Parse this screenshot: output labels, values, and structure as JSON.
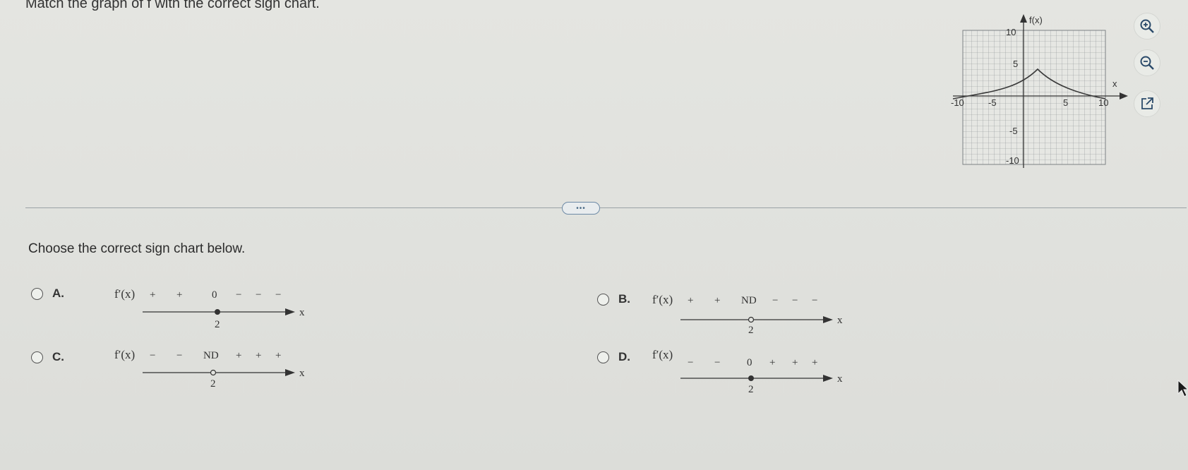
{
  "question": "Match the graph of f with the correct sign chart.",
  "graph": {
    "y_label": "f(x)",
    "x_label": "x",
    "y_ticks": [
      "10",
      "5",
      "-5",
      "-10"
    ],
    "x_ticks": [
      "-10",
      "-5",
      "5",
      "10"
    ]
  },
  "tools": {
    "zoom_in": "zoom-in-icon",
    "zoom_out": "zoom-out-icon",
    "popout": "external-link-icon"
  },
  "divider_grabber": "•••",
  "prompt": "Choose the correct sign chart below.",
  "options": [
    {
      "letter": "A.",
      "fn": "f′(x)",
      "signs_left": [
        "+",
        "+"
      ],
      "mid": "0",
      "signs_right": [
        "−",
        "−",
        "−"
      ],
      "point": "2",
      "closed": true,
      "axis": "x"
    },
    {
      "letter": "B.",
      "fn": "f′(x)",
      "signs_left": [
        "+",
        "+"
      ],
      "mid": "ND",
      "signs_right": [
        "−",
        "−",
        "−"
      ],
      "point": "2",
      "closed": false,
      "axis": "x"
    },
    {
      "letter": "C.",
      "fn": "f′(x)",
      "signs_left": [
        "−",
        "−"
      ],
      "mid": "ND",
      "signs_right": [
        "+",
        "+",
        "+"
      ],
      "point": "2",
      "closed": false,
      "axis": "x"
    },
    {
      "letter": "D.",
      "fn": "f′(x)",
      "signs_left": [
        "−",
        "−"
      ],
      "mid": "0",
      "signs_right": [
        "+",
        "+",
        "+"
      ],
      "point": "2",
      "closed": true,
      "axis": "x"
    }
  ]
}
